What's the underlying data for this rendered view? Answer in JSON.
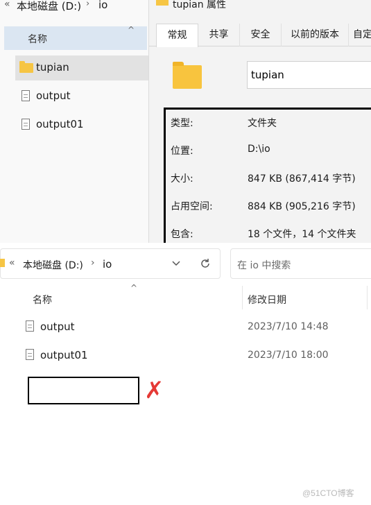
{
  "top_explorer": {
    "nav_back": "«",
    "breadcrumb": [
      "本地磁盘 (D:)",
      "io"
    ],
    "column_name": "名称",
    "items": [
      {
        "name": "tupian",
        "type": "folder",
        "selected": true
      },
      {
        "name": "output",
        "type": "file"
      },
      {
        "name": "output01",
        "type": "file"
      }
    ]
  },
  "properties_dialog": {
    "title": "tupian 属性",
    "tabs": [
      "常规",
      "共享",
      "安全",
      "以前的版本",
      "自定"
    ],
    "active_tab": "常规",
    "folder_name": "tupian",
    "rows": [
      {
        "label": "类型:",
        "value": "文件夹"
      },
      {
        "label": "位置:",
        "value": "D:\\io"
      },
      {
        "label": "大小:",
        "value": "847 KB (867,414 字节)"
      },
      {
        "label": "占用空间:",
        "value": "884 KB (905,216 字节)"
      },
      {
        "label": "包含:",
        "value": "18 个文件，14 个文件夹"
      }
    ]
  },
  "bottom_explorer": {
    "nav_back": "«",
    "breadcrumb": [
      "本地磁盘 (D:)",
      "io"
    ],
    "search_placeholder": "在 io 中搜索",
    "columns": {
      "name": "名称",
      "modified": "修改日期"
    },
    "files": [
      {
        "name": "output",
        "modified": "2023/7/10 14:48"
      },
      {
        "name": "output01",
        "modified": "2023/7/10 18:00"
      }
    ],
    "rename_value": "",
    "error_mark": "✗"
  },
  "watermark": "@51CTO博客",
  "colors": {
    "folder": "#f6c544",
    "error": "#e53935",
    "selection": "#e2e2e2",
    "header_highlight": "#dbe6f2"
  }
}
